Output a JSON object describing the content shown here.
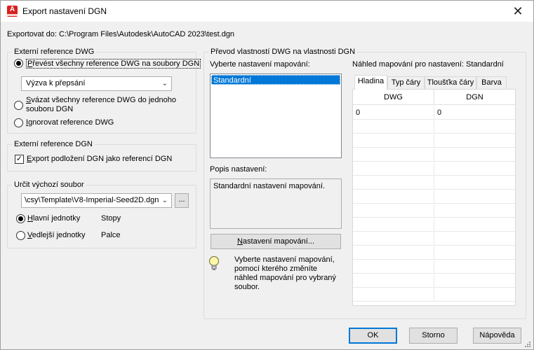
{
  "window": {
    "title": "Export nastavení DGN",
    "icon_letter": "A"
  },
  "export_path": "Exportovat do: C:\\Program Files\\Autodesk\\AutoCAD 2023\\test.dgn",
  "xref_dwg": {
    "legend": "Externí reference DWG",
    "option_convert_prefix": "P",
    "option_convert_rest": "řevést všechny reference DWG na soubory DGN",
    "prompt_combo": "Výzva k přepsání",
    "option_bind_prefix": "S",
    "option_bind_rest_line1": "vázat všechny reference DWG do jednoho",
    "option_bind_line2": "souboru DGN",
    "option_ignore_prefix": "I",
    "option_ignore_rest": "gnorovat reference DWG",
    "selected": "convert"
  },
  "xref_dgn": {
    "legend": "Externí reference DGN",
    "checkbox_prefix": "E",
    "checkbox_rest": "xport podložení DGN jako referencí DGN",
    "checked": true
  },
  "seed": {
    "legend": "Určit výchozí soubor",
    "file_combo": "\\csy\\Template\\V8-Imperial-Seed2D.dgn",
    "browse_label": "...",
    "main_units_prefix": "H",
    "main_units_rest": "lavní jednotky",
    "main_units_value": "Stopy",
    "sub_units_prefix": "V",
    "sub_units_rest": "edlejší jednotky",
    "sub_units_value": "Palce",
    "selected": "main"
  },
  "mapping": {
    "legend": "Převod vlastností DWG na vlastnosti DGN",
    "select_label": "Vyberte nastavení mapování:",
    "setups": [
      "Standardní"
    ],
    "selected_setup": "Standardní",
    "description_label": "Popis nastavení:",
    "description_text": "Standardní nastavení mapování.",
    "setup_button": "Nastavení mapování...",
    "tip_text": "Vyberte nastavení mapování, pomocí kterého změníte náhled mapování pro vybraný soubor.",
    "preview_label": "Náhled mapování pro nastavení: Standardní",
    "tabs": [
      "Hladina",
      "Typ čáry",
      "Tloušťka čáry",
      "Barva"
    ],
    "active_tab": "Hladina",
    "columns": [
      "DWG",
      "DGN"
    ],
    "rows": [
      [
        "0",
        "0"
      ]
    ]
  },
  "buttons": {
    "ok": "OK",
    "cancel": "Storno",
    "help": "Nápověda"
  },
  "colors": {
    "accent": "#0078d7",
    "app_icon": "#d7201f"
  }
}
